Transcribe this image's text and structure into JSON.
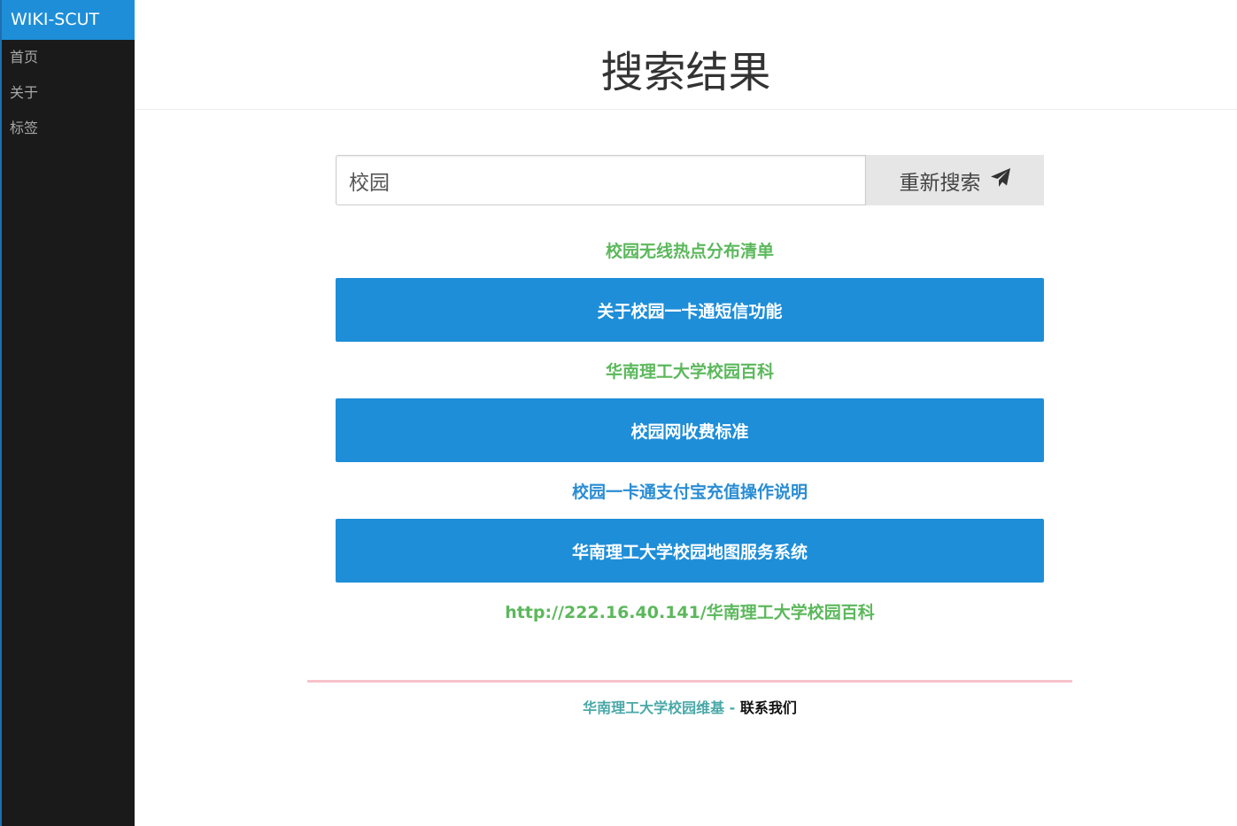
{
  "sidebar": {
    "brand": "WIKI-SCUT",
    "items": [
      {
        "label": "首页"
      },
      {
        "label": "关于"
      },
      {
        "label": "标签"
      }
    ]
  },
  "header": {
    "title": "搜索结果"
  },
  "search": {
    "value": "校园",
    "button_label": "重新搜索",
    "button_icon": "paper-plane-icon"
  },
  "results": [
    {
      "label": "校园无线热点分布清单",
      "style": "plain",
      "color": "#5cb85c"
    },
    {
      "label": "关于校园一卡通短信功能",
      "style": "filled",
      "color": "#ffffff"
    },
    {
      "label": "华南理工大学校园百科",
      "style": "plain",
      "color": "#5cb85c"
    },
    {
      "label": "校园网收费标准",
      "style": "filled",
      "color": "#ffffff"
    },
    {
      "label": "校园一卡通支付宝充值操作说明",
      "style": "plain",
      "color": "#2a8dd4"
    },
    {
      "label": "华南理工大学校园地图服务系统",
      "style": "filled",
      "color": "#ffffff"
    },
    {
      "label": "http://222.16.40.141/华南理工大学校园百科",
      "style": "plain",
      "color": "#5cb85c"
    }
  ],
  "footer": {
    "site_name": "华南理工大学校园维基",
    "separator": "-",
    "contact": "联系我们"
  },
  "colors": {
    "accent": "#1e8ed8",
    "sidebar_bg": "#1a1a1a",
    "footer_rule": "#f7c3cc"
  }
}
